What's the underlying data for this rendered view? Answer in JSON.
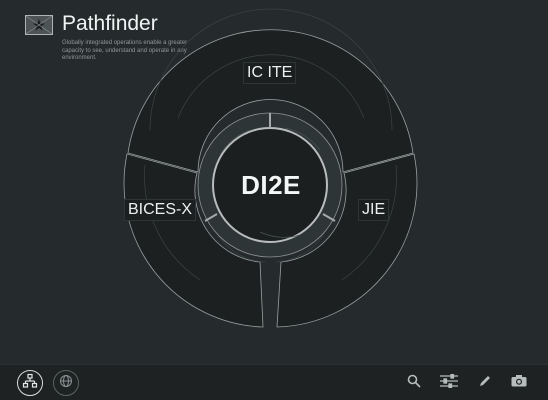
{
  "app": {
    "title": "Pathfinder",
    "description": "Globally integrated operations enable a greater capacity to see, understand and operate in any environment."
  },
  "diagram": {
    "center": "DI2E",
    "segments": [
      {
        "label": "IC ITE"
      },
      {
        "label": "BICES-X"
      },
      {
        "label": "JIE"
      }
    ]
  },
  "colors": {
    "background": "#252b2c",
    "ring_fill": "#1d2021",
    "ring_stroke": "#9aa0a1",
    "toolbar": "#1e2223"
  },
  "toolbar": {
    "left": [
      {
        "icon": "network-icon",
        "active": true
      },
      {
        "icon": "globe-icon",
        "active": false
      }
    ],
    "right": [
      {
        "icon": "search-icon"
      },
      {
        "icon": "sliders-icon"
      },
      {
        "icon": "pencil-icon"
      },
      {
        "icon": "camera-icon"
      }
    ]
  }
}
